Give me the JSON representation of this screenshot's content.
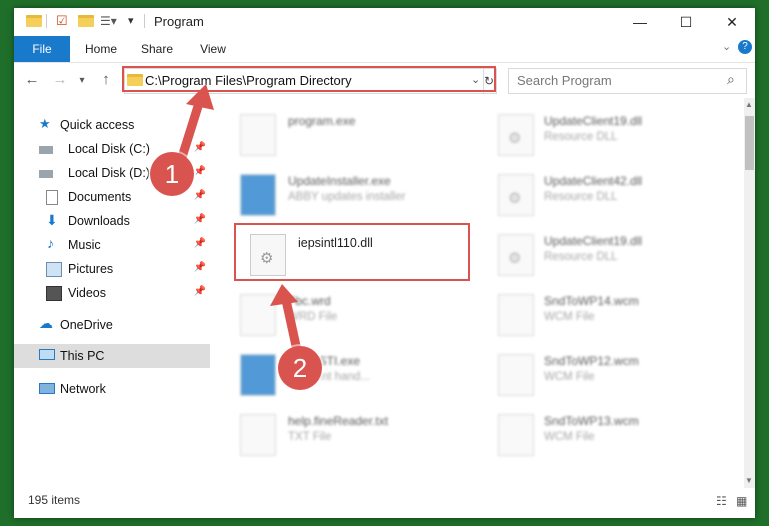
{
  "window": {
    "title": "Program",
    "minimize": "—",
    "maximize": "☐",
    "close": "✕"
  },
  "ribbon": {
    "tabs": [
      "File",
      "Home",
      "Share",
      "View"
    ],
    "help": "?"
  },
  "address": {
    "path": "C:\\Program Files\\Program Directory",
    "search_placeholder": "Search Program"
  },
  "sidebar": {
    "items": [
      {
        "label": "Quick access",
        "icon": "star-icon"
      },
      {
        "label": "Local Disk (C:)",
        "icon": "drive-icon",
        "pinned": true
      },
      {
        "label": "Local Disk (D:)",
        "icon": "drive-icon",
        "pinned": true
      },
      {
        "label": "Documents",
        "icon": "documents-icon",
        "pinned": true
      },
      {
        "label": "Downloads",
        "icon": "download-icon",
        "pinned": true
      },
      {
        "label": "Music",
        "icon": "music-icon",
        "pinned": true
      },
      {
        "label": "Pictures",
        "icon": "pictures-icon",
        "pinned": true
      },
      {
        "label": "Videos",
        "icon": "videos-icon",
        "pinned": true
      },
      {
        "label": "OneDrive",
        "icon": "cloud-icon"
      },
      {
        "label": "This PC",
        "icon": "pc-icon",
        "selected": true
      },
      {
        "label": "Network",
        "icon": "network-icon"
      }
    ]
  },
  "files": {
    "left": [
      {
        "name": "program.exe",
        "type": ""
      },
      {
        "name": "UpdateInstaller.exe",
        "type": "ABBY updates installer"
      },
      {
        "name": "iepsintl110.dll",
        "type": ""
      },
      {
        "name": "Fbc.wrd",
        "type": "WRD File"
      },
      {
        "name": "ProxySTI.exe",
        "type": "ds event hand..."
      },
      {
        "name": "help.fineReader.txt",
        "type": "TXT File"
      }
    ],
    "right": [
      {
        "name": "UpdateClient19.dll",
        "type": "Resource DLL"
      },
      {
        "name": "UpdateClient42.dll",
        "type": "Resource DLL"
      },
      {
        "name": "UpdateClient19.dll",
        "type": "Resource DLL"
      },
      {
        "name": "SndToWP14.wcm",
        "type": "WCM File"
      },
      {
        "name": "SndToWP12.wcm",
        "type": "WCM File"
      },
      {
        "name": "SndToWP13.wcm",
        "type": "WCM File"
      }
    ]
  },
  "status": {
    "items": "195 items"
  },
  "annotations": {
    "step1": "1",
    "step2": "2",
    "color": "#d9534f"
  }
}
